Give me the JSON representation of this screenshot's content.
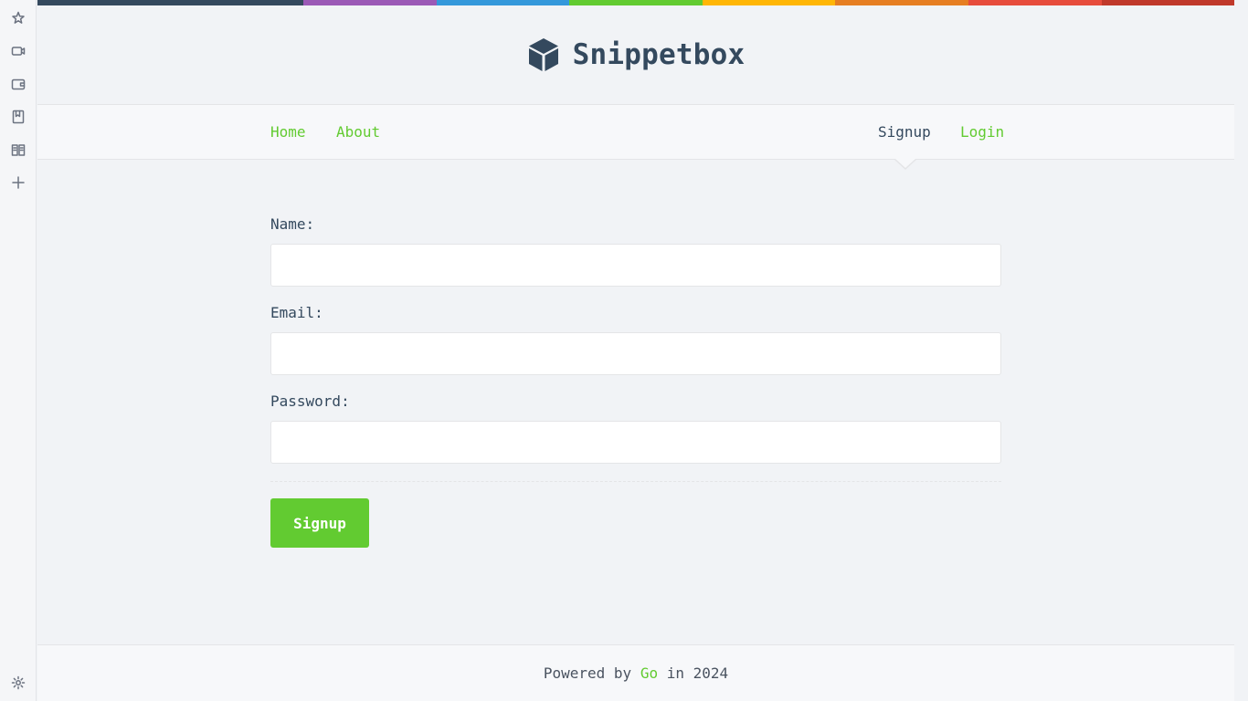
{
  "brand": {
    "name": "Snippetbox"
  },
  "stripe_colors": [
    "#34495e",
    "#34495e",
    "#9b59b6",
    "#3498db",
    "#62cb31",
    "#ffb606",
    "#e67e22",
    "#e74c3c",
    "#c0392b"
  ],
  "nav": {
    "left": [
      {
        "label": "Home"
      },
      {
        "label": "About"
      }
    ],
    "right": [
      {
        "label": "Signup",
        "active": true
      },
      {
        "label": "Login"
      }
    ]
  },
  "form": {
    "name_label": "Name:",
    "name_value": "",
    "email_label": "Email:",
    "email_value": "",
    "password_label": "Password:",
    "password_value": "",
    "submit_label": "Signup"
  },
  "footer": {
    "prefix": "Powered by ",
    "link": "Go",
    "suffix": " in 2024"
  },
  "sidebar_icons": [
    "sparkle-icon",
    "video-icon",
    "wallet-icon",
    "bookmark-icon",
    "book-icon",
    "plus-icon",
    "settings-icon"
  ],
  "colors": {
    "accent": "#62cb31",
    "text": "#34495e"
  }
}
